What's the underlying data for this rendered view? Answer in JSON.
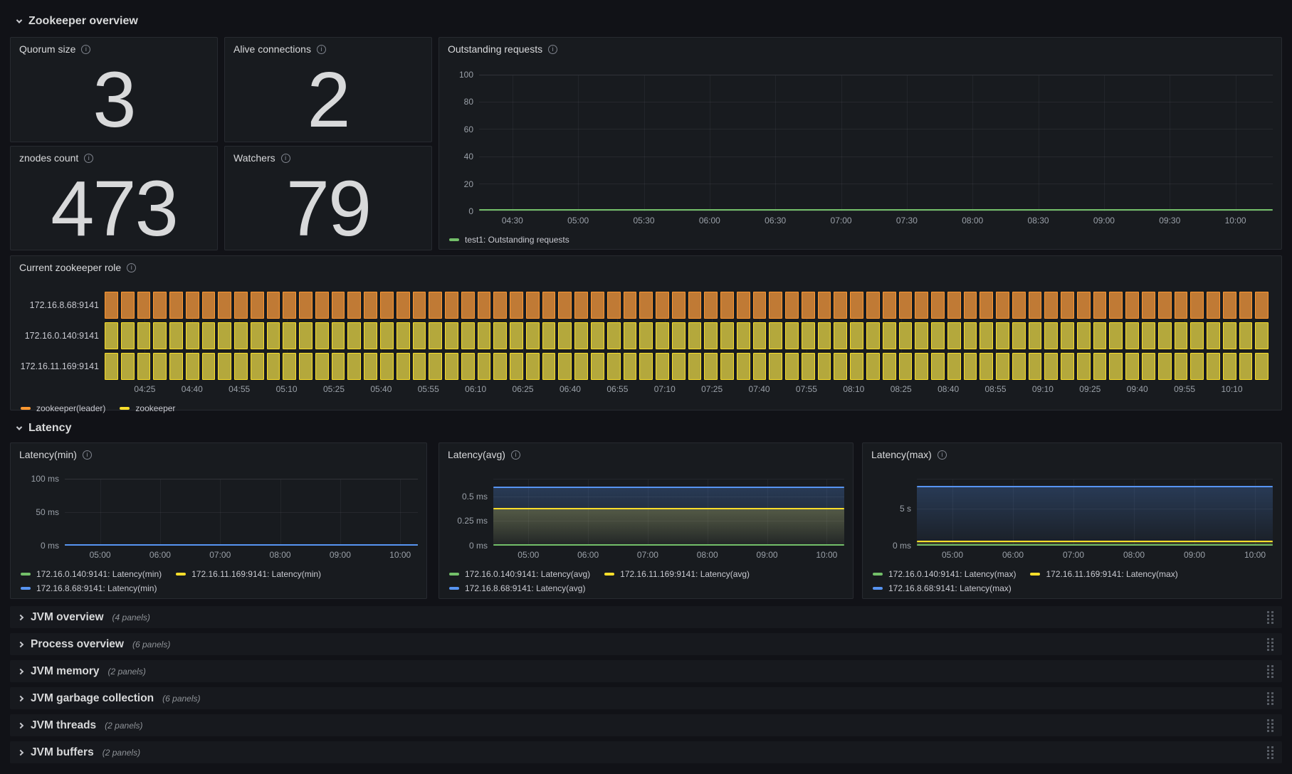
{
  "sections": {
    "overview": {
      "title": "Zookeeper overview"
    },
    "latency": {
      "title": "Latency"
    }
  },
  "stats": [
    {
      "title": "Quorum size",
      "value": "3"
    },
    {
      "title": "Alive connections",
      "value": "2"
    },
    {
      "title": "znodes count",
      "value": "473"
    },
    {
      "title": "Watchers",
      "value": "79"
    }
  ],
  "colors": {
    "green": "#73BF69",
    "yellow": "#FADE2A",
    "blue": "#5794F2",
    "orange": "#FF9830",
    "orange_fill": "#c07a35",
    "yellow_fill": "#b4a83c"
  },
  "icons": {
    "panel_info": "info-icon (circled i)",
    "section_expanded": "chevron-down-icon",
    "row_collapsed": "chevron-right-icon",
    "row_drag": "drag-handle-dots-icon"
  },
  "charts": {
    "outstanding": {
      "title": "Outstanding requests",
      "y_ticks": [
        {
          "label": "0",
          "frac": 0
        },
        {
          "label": "20",
          "frac": 0.2
        },
        {
          "label": "40",
          "frac": 0.4
        },
        {
          "label": "60",
          "frac": 0.6
        },
        {
          "label": "80",
          "frac": 0.8
        },
        {
          "label": "100",
          "frac": 1
        }
      ],
      "x_ticks": [
        "04:30",
        "05:00",
        "05:30",
        "06:00",
        "06:30",
        "07:00",
        "07:30",
        "08:00",
        "08:30",
        "09:00",
        "09:30",
        "10:00"
      ],
      "series": [
        {
          "name": "test1: Outstanding requests",
          "color": "#73BF69",
          "frac": 0.012,
          "fill": false
        }
      ],
      "legend": [
        {
          "color": "#73BF69",
          "label": "test1: Outstanding requests"
        }
      ]
    },
    "timeline": {
      "title": "Current zookeeper role",
      "bar_count": 72,
      "rows": [
        {
          "label": "172.16.8.68:9141",
          "state": "zookeeper(leader)",
          "border": "#FF9830",
          "fill": "#c07a35"
        },
        {
          "label": "172.16.0.140:9141",
          "state": "zookeeper",
          "border": "#FADE2A",
          "fill": "#b4a83c"
        },
        {
          "label": "172.16.11.169:9141",
          "state": "zookeeper",
          "border": "#FADE2A",
          "fill": "#b4a83c"
        }
      ],
      "x_ticks": [
        "04:25",
        "04:40",
        "04:55",
        "05:10",
        "05:25",
        "05:40",
        "05:55",
        "06:10",
        "06:25",
        "06:40",
        "06:55",
        "07:10",
        "07:25",
        "07:40",
        "07:55",
        "08:10",
        "08:25",
        "08:40",
        "08:55",
        "09:10",
        "09:25",
        "09:40",
        "09:55",
        "10:10"
      ],
      "legend": [
        {
          "color": "#FF9830",
          "label": "zookeeper(leader)"
        },
        {
          "color": "#FADE2A",
          "label": "zookeeper"
        }
      ]
    },
    "lat_min": {
      "title": "Latency(min)",
      "y_ticks": [
        {
          "label": "0 ms",
          "frac": 0
        },
        {
          "label": "50 ms",
          "frac": 0.5
        },
        {
          "label": "100 ms",
          "frac": 1
        }
      ],
      "x_ticks": [
        "05:00",
        "06:00",
        "07:00",
        "08:00",
        "09:00",
        "10:00"
      ],
      "series": [
        {
          "name": "172.16.0.140:9141: Latency(min)",
          "color": "#73BF69",
          "frac": 0.012,
          "fill": false
        },
        {
          "name": "172.16.11.169:9141: Latency(min)",
          "color": "#FADE2A",
          "frac": 0.012,
          "fill": false
        },
        {
          "name": "172.16.8.68:9141: Latency(min)",
          "color": "#5794F2",
          "frac": 0.012,
          "fill": false
        }
      ],
      "legend": [
        {
          "color": "#73BF69",
          "label": "172.16.0.140:9141: Latency(min)"
        },
        {
          "color": "#FADE2A",
          "label": "172.16.11.169:9141: Latency(min)"
        },
        {
          "color": "#5794F2",
          "label": "172.16.8.68:9141: Latency(min)"
        }
      ]
    },
    "lat_avg": {
      "title": "Latency(avg)",
      "y_ticks": [
        {
          "label": "0 ms",
          "frac": 0
        },
        {
          "label": "0.25 ms",
          "frac": 0.368
        },
        {
          "label": "0.5 ms",
          "frac": 0.736
        }
      ],
      "x_ticks": [
        "05:00",
        "06:00",
        "07:00",
        "08:00",
        "09:00",
        "10:00"
      ],
      "series": [
        {
          "name": "172.16.0.140:9141: Latency(avg)",
          "color": "#73BF69",
          "frac": 0.012,
          "fill": false
        },
        {
          "name": "172.16.11.169:9141: Latency(avg)",
          "color": "#FADE2A",
          "frac": 0.555,
          "fill": true
        },
        {
          "name": "172.16.8.68:9141: Latency(avg)",
          "color": "#5794F2",
          "frac": 0.885,
          "fill": true
        }
      ],
      "legend": [
        {
          "color": "#73BF69",
          "label": "172.16.0.140:9141: Latency(avg)"
        },
        {
          "color": "#FADE2A",
          "label": "172.16.11.169:9141: Latency(avg)"
        },
        {
          "color": "#5794F2",
          "label": "172.16.8.68:9141: Latency(avg)"
        }
      ]
    },
    "lat_max": {
      "title": "Latency(max)",
      "y_ticks": [
        {
          "label": "0 ms",
          "frac": 0
        },
        {
          "label": "5 s",
          "frac": 0.553
        }
      ],
      "x_ticks": [
        "05:00",
        "06:00",
        "07:00",
        "08:00",
        "09:00",
        "10:00"
      ],
      "series": [
        {
          "name": "172.16.0.140:9141: Latency(max)",
          "color": "#73BF69",
          "frac": 0.015,
          "fill": false
        },
        {
          "name": "172.16.11.169:9141: Latency(max)",
          "color": "#FADE2A",
          "frac": 0.07,
          "fill": true
        },
        {
          "name": "172.16.8.68:9141: Latency(max)",
          "color": "#5794F2",
          "frac": 0.895,
          "fill": true
        }
      ],
      "legend": [
        {
          "color": "#73BF69",
          "label": "172.16.0.140:9141: Latency(max)"
        },
        {
          "color": "#FADE2A",
          "label": "172.16.11.169:9141: Latency(max)"
        },
        {
          "color": "#5794F2",
          "label": "172.16.8.68:9141: Latency(max)"
        }
      ]
    }
  },
  "collapsed_rows": [
    {
      "title": "JVM overview",
      "count": "(4 panels)"
    },
    {
      "title": "Process overview",
      "count": "(6 panels)"
    },
    {
      "title": "JVM memory",
      "count": "(2 panels)"
    },
    {
      "title": "JVM garbage collection",
      "count": "(6 panels)"
    },
    {
      "title": "JVM threads",
      "count": "(2 panels)"
    },
    {
      "title": "JVM buffers",
      "count": "(2 panels)"
    }
  ],
  "chart_data": [
    {
      "type": "line",
      "title": "Outstanding requests",
      "x": [
        "04:30",
        "05:00",
        "05:30",
        "06:00",
        "06:30",
        "07:00",
        "07:30",
        "08:00",
        "08:30",
        "09:00",
        "09:30",
        "10:00"
      ],
      "ylim": [
        0,
        100
      ],
      "grid": true,
      "legend_position": "bottom",
      "series": [
        {
          "name": "test1: Outstanding requests",
          "color": "#73BF69",
          "constant_value": 0
        }
      ]
    },
    {
      "type": "heatmap",
      "subtype": "state-timeline",
      "title": "Current zookeeper role",
      "x": [
        "04:25",
        "04:40",
        "04:55",
        "05:10",
        "05:25",
        "05:40",
        "05:55",
        "06:10",
        "06:25",
        "06:40",
        "06:55",
        "07:10",
        "07:25",
        "07:40",
        "07:55",
        "08:10",
        "08:25",
        "08:40",
        "08:55",
        "09:10",
        "09:25",
        "09:40",
        "09:55",
        "10:10"
      ],
      "rows": [
        {
          "label": "172.16.8.68:9141",
          "state_entire_range": "zookeeper(leader)",
          "color": "#FF9830"
        },
        {
          "label": "172.16.0.140:9141",
          "state_entire_range": "zookeeper",
          "color": "#FADE2A"
        },
        {
          "label": "172.16.11.169:9141",
          "state_entire_range": "zookeeper",
          "color": "#FADE2A"
        }
      ],
      "legend": [
        "zookeeper(leader)",
        "zookeeper"
      ]
    },
    {
      "type": "line",
      "title": "Latency(min)",
      "x": [
        "05:00",
        "06:00",
        "07:00",
        "08:00",
        "09:00",
        "10:00"
      ],
      "y_tick_labels": [
        "0 ms",
        "50 ms",
        "100 ms"
      ],
      "ylim_ms": [
        0,
        100
      ],
      "series": [
        {
          "name": "172.16.0.140:9141: Latency(min)",
          "color": "#73BF69",
          "constant_value_ms": 0
        },
        {
          "name": "172.16.11.169:9141: Latency(min)",
          "color": "#FADE2A",
          "constant_value_ms": 0
        },
        {
          "name": "172.16.8.68:9141: Latency(min)",
          "color": "#5794F2",
          "constant_value_ms": 0
        }
      ]
    },
    {
      "type": "line",
      "title": "Latency(avg)",
      "x": [
        "05:00",
        "06:00",
        "07:00",
        "08:00",
        "09:00",
        "10:00"
      ],
      "y_tick_labels": [
        "0 ms",
        "0.25 ms",
        "0.5 ms"
      ],
      "ylim_ms": [
        0,
        0.68
      ],
      "series": [
        {
          "name": "172.16.0.140:9141: Latency(avg)",
          "color": "#73BF69",
          "constant_value_ms": 0
        },
        {
          "name": "172.16.11.169:9141: Latency(avg)",
          "color": "#FADE2A",
          "constant_value_ms": 0.38
        },
        {
          "name": "172.16.8.68:9141: Latency(avg)",
          "color": "#5794F2",
          "constant_value_ms": 0.6
        }
      ]
    },
    {
      "type": "line",
      "title": "Latency(max)",
      "x": [
        "05:00",
        "06:00",
        "07:00",
        "08:00",
        "09:00",
        "10:00"
      ],
      "y_tick_labels": [
        "0 ms",
        "5 s"
      ],
      "ylim_s": [
        0,
        9
      ],
      "series": [
        {
          "name": "172.16.0.140:9141: Latency(max)",
          "color": "#73BF69",
          "constant_value_s": 0.1
        },
        {
          "name": "172.16.11.169:9141: Latency(max)",
          "color": "#FADE2A",
          "constant_value_s": 0.6
        },
        {
          "name": "172.16.8.68:9141: Latency(max)",
          "color": "#5794F2",
          "constant_value_s": 8
        }
      ]
    }
  ]
}
